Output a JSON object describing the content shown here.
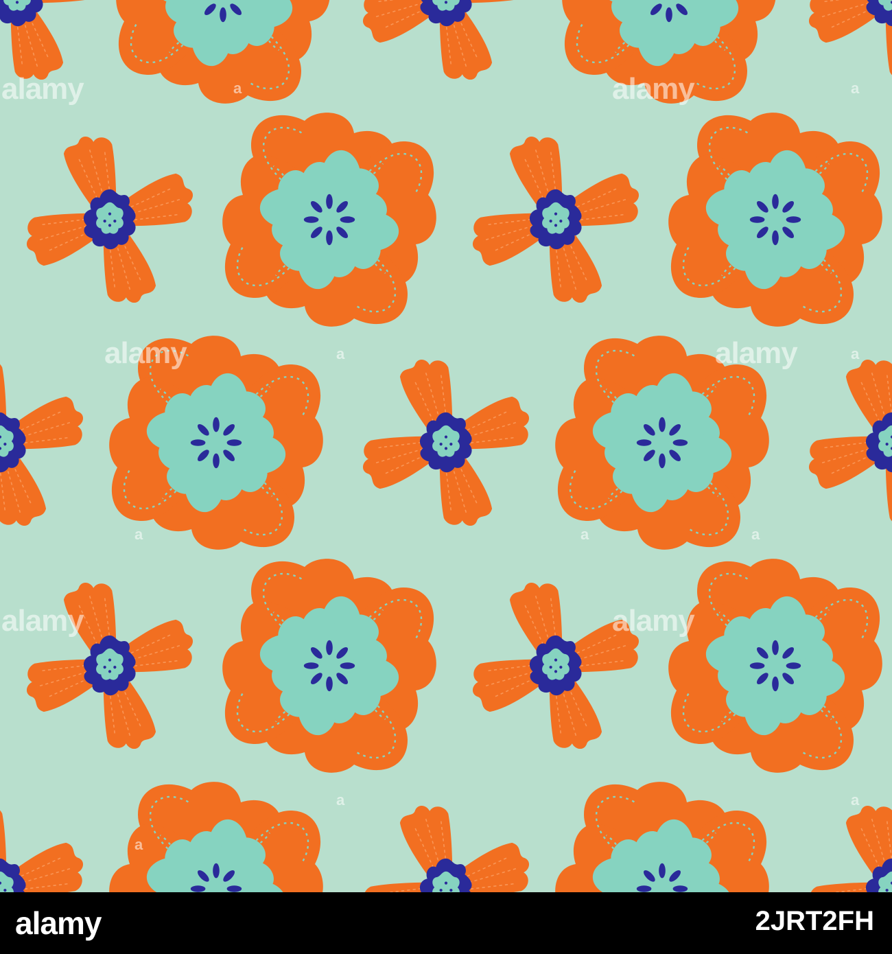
{
  "pattern": {
    "background_color": "#b8dfcd",
    "petal_color": "#f26f21",
    "inner_color": "#86d3c0",
    "center_color": "#2a2a9a",
    "stitch_color": "#86d3c0"
  },
  "watermark": {
    "word": "alamy",
    "mark": "a"
  },
  "footer": {
    "logo": "alamy",
    "image_id": "2JRT2FH"
  }
}
